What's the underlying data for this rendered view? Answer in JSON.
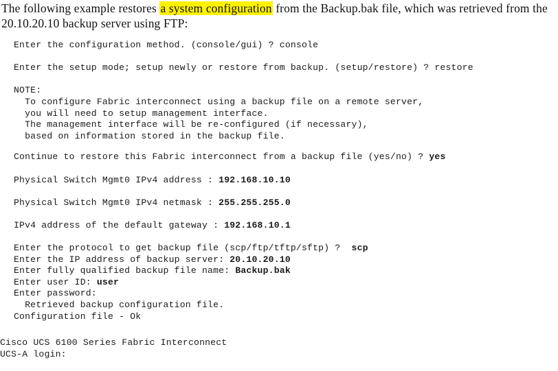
{
  "document": {
    "intro": {
      "before_highlight": "The following example restores ",
      "highlighted": "a system configuration",
      "after_highlight": " from the Backup.bak file, which was retrieved from the 20.10.20.10 backup server using FTP:",
      "highlight_color": "#fff200"
    },
    "console": {
      "blocks": [
        {
          "id": "config-method",
          "indent": "indent",
          "lines": [
            {
              "prompt": "Enter the configuration method. (console/gui) ? console",
              "input": ""
            }
          ]
        },
        {
          "id": "setup-mode",
          "indent": "indent",
          "lines": [
            {
              "prompt": "Enter the setup mode; setup newly or restore from backup. (setup/restore) ? restore",
              "input": ""
            }
          ]
        },
        {
          "id": "note",
          "indent": "indent",
          "lines": [
            {
              "prompt": "NOTE:",
              "input": ""
            },
            {
              "prompt": "  To configure Fabric interconnect using a backup file on a remote server,",
              "input": ""
            },
            {
              "prompt": "  you will need to setup management interface.",
              "input": ""
            },
            {
              "prompt": "  The management interface will be re-configured (if necessary),",
              "input": ""
            },
            {
              "prompt": "  based on information stored in the backup file.",
              "input": ""
            }
          ]
        },
        {
          "id": "continue-restore",
          "indent": "indent",
          "lines": [
            {
              "prompt": "Continue to restore this Fabric interconnect from a backup file (yes/no) ? ",
              "input": "yes"
            }
          ]
        },
        {
          "id": "mgmt-ipv4-address",
          "indent": "indent",
          "lines": [
            {
              "prompt": "Physical Switch Mgmt0 IPv4 address : ",
              "input": "192.168.10.10"
            }
          ]
        },
        {
          "id": "mgmt-ipv4-netmask",
          "indent": "indent",
          "lines": [
            {
              "prompt": "Physical Switch Mgmt0 IPv4 netmask : ",
              "input": "255.255.255.0"
            }
          ]
        },
        {
          "id": "default-gateway",
          "indent": "indent",
          "lines": [
            {
              "prompt": "IPv4 address of the default gateway : ",
              "input": "192.168.10.1"
            }
          ]
        },
        {
          "id": "backup-transfer",
          "indent": "indent",
          "lines": [
            {
              "prompt": "Enter the protocol to get backup file (scp/ftp/tftp/sftp) ?  ",
              "input": "scp"
            },
            {
              "prompt": "Enter the IP address of backup server: ",
              "input": "20.10.20.10"
            },
            {
              "prompt": "Enter fully qualified backup file name: ",
              "input": "Backup.bak"
            },
            {
              "prompt": "Enter user ID: ",
              "input": "user"
            },
            {
              "prompt": "Enter password:",
              "input": ""
            },
            {
              "prompt": "  Retrieved backup configuration file.",
              "input": ""
            },
            {
              "prompt": "Configuration file - Ok",
              "input": ""
            }
          ]
        },
        {
          "id": "login-banner",
          "indent": "flush",
          "lines": [
            {
              "prompt": "Cisco UCS 6100 Series Fabric Interconnect",
              "input": ""
            },
            {
              "prompt": "UCS-A login:",
              "input": ""
            }
          ]
        }
      ]
    }
  }
}
